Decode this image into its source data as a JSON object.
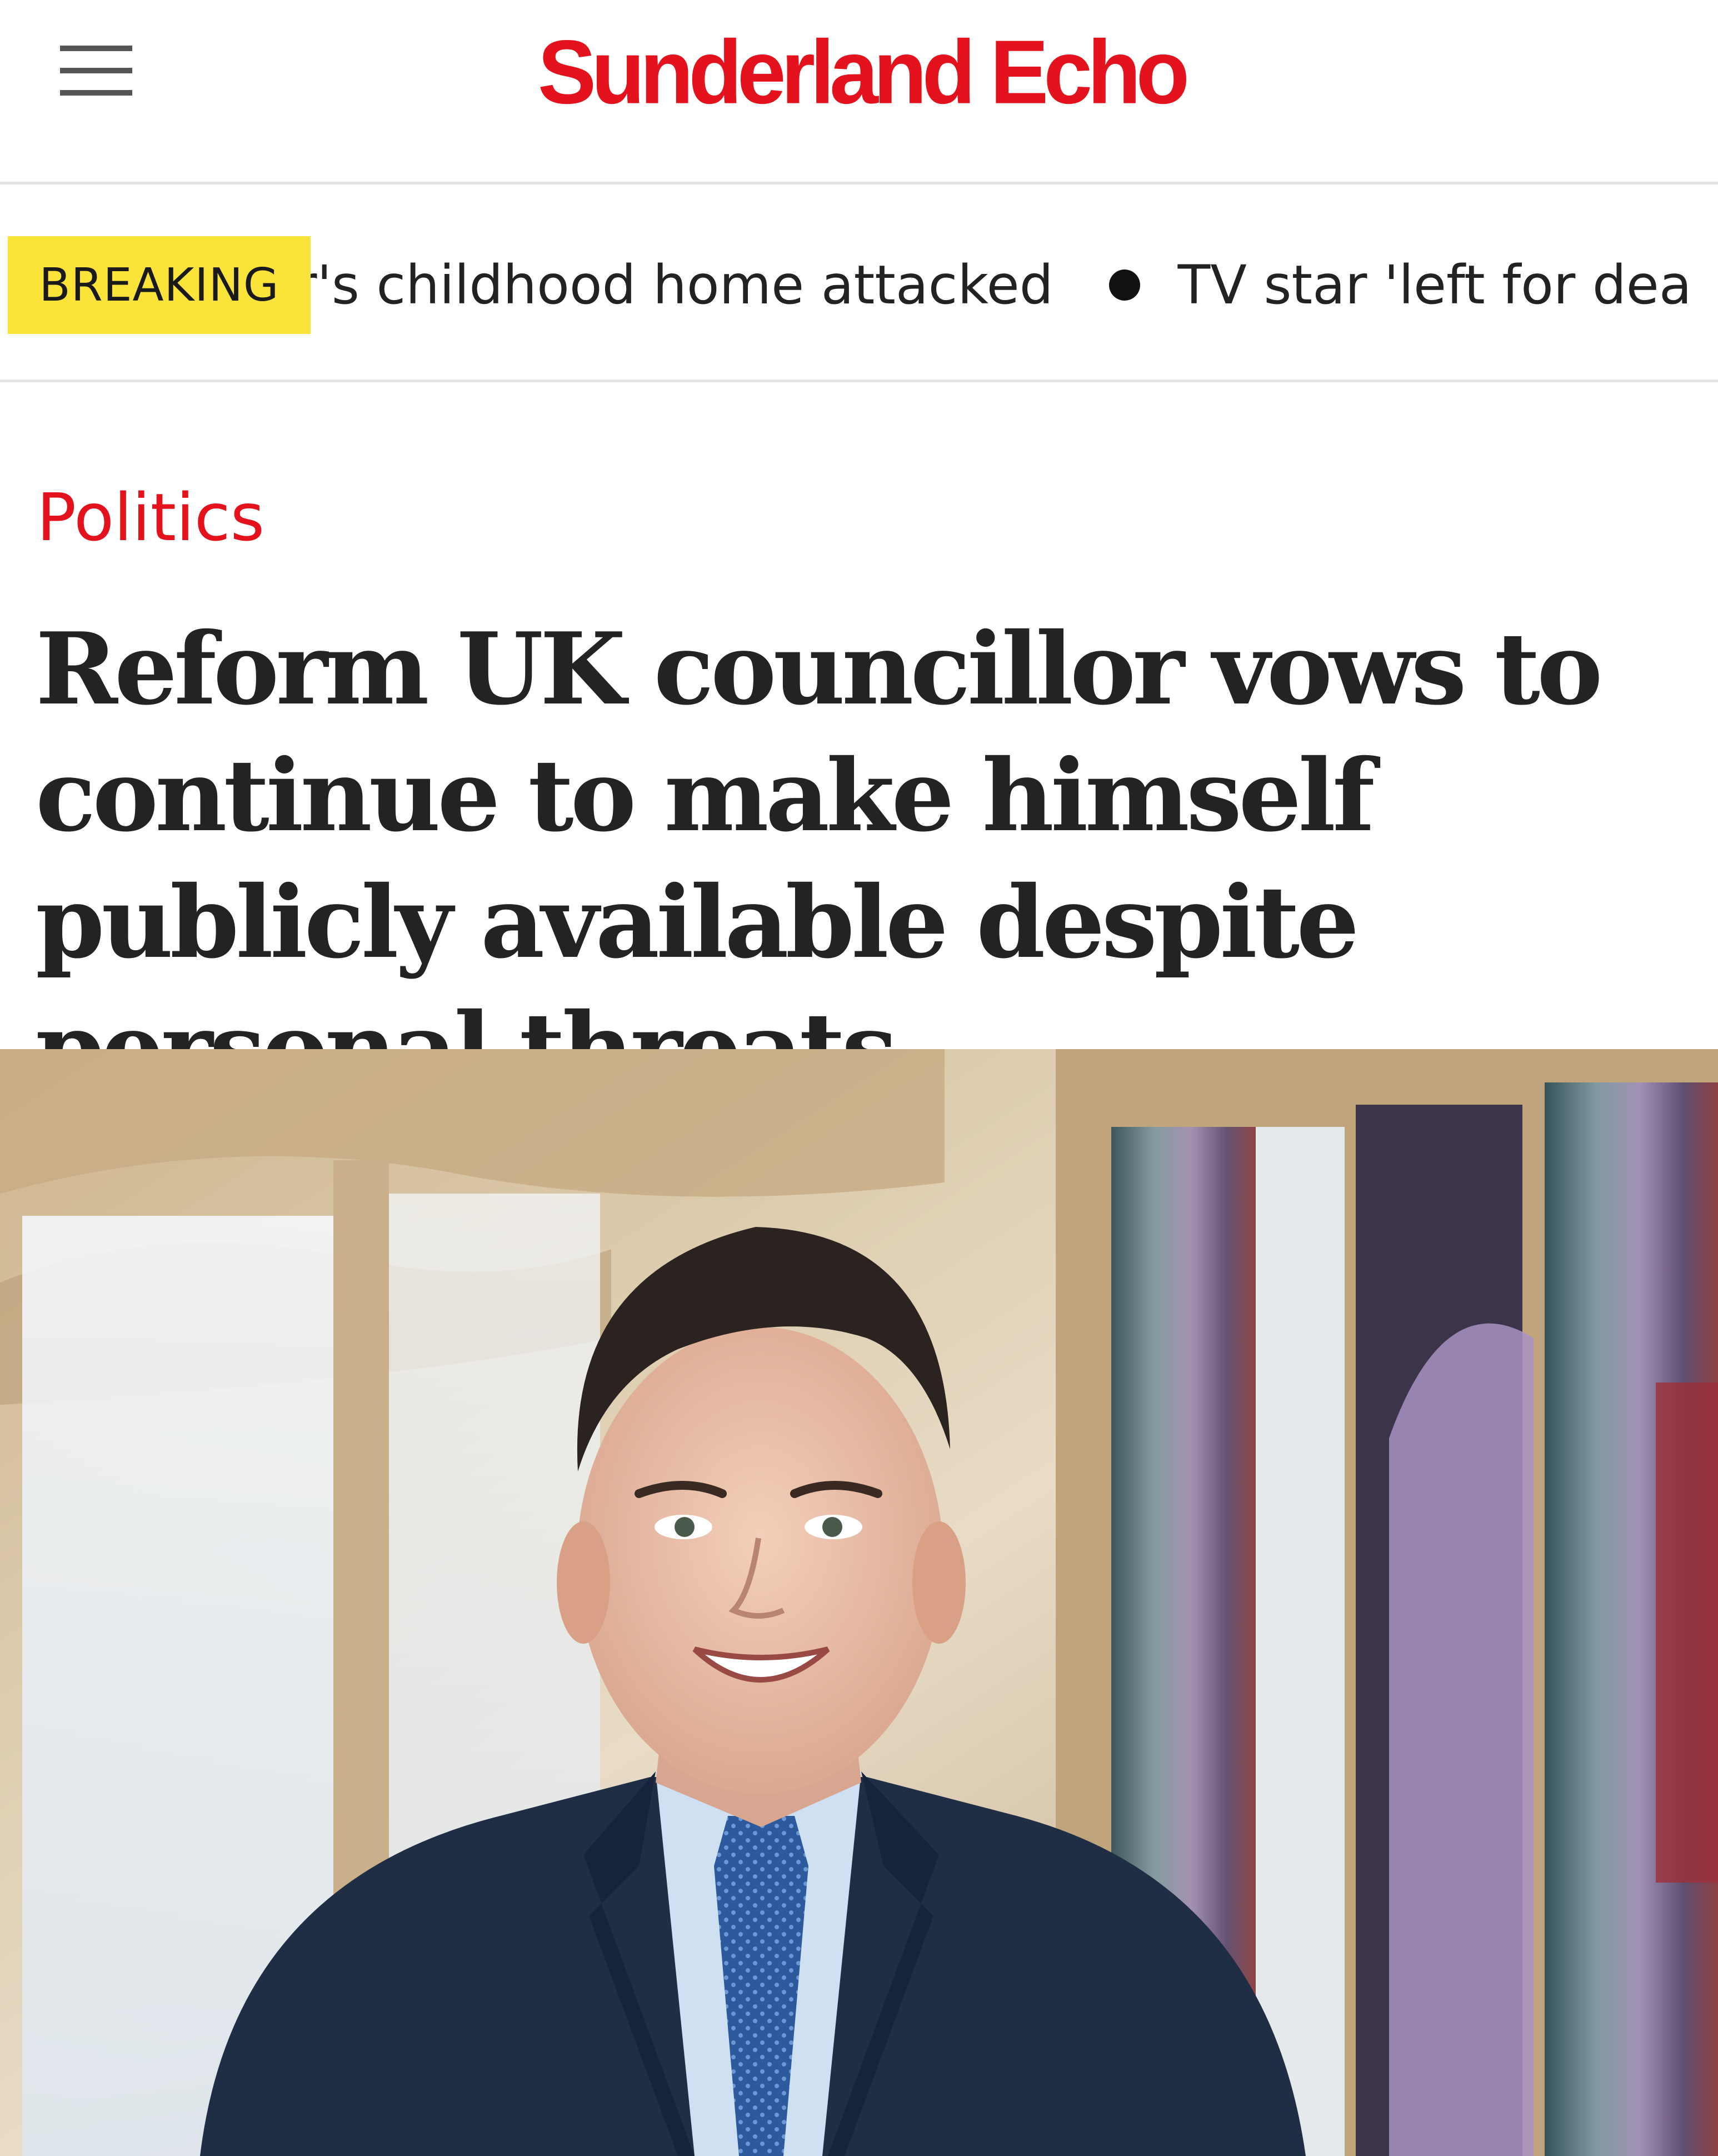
{
  "site": {
    "logo_text": "Sunderland Echo",
    "brand_color": "#e4121c"
  },
  "header": {
    "menu_icon": "hamburger-menu-icon"
  },
  "ticker": {
    "badge_label": "BREAKING",
    "badge_color": "#fbe43a",
    "items": [
      "r's childhood home attacked",
      "TV star 'left for dea"
    ]
  },
  "article": {
    "section": "Politics",
    "headline": "Reform UK councillor vows to continue to make himself publicly available despite personal threats"
  }
}
